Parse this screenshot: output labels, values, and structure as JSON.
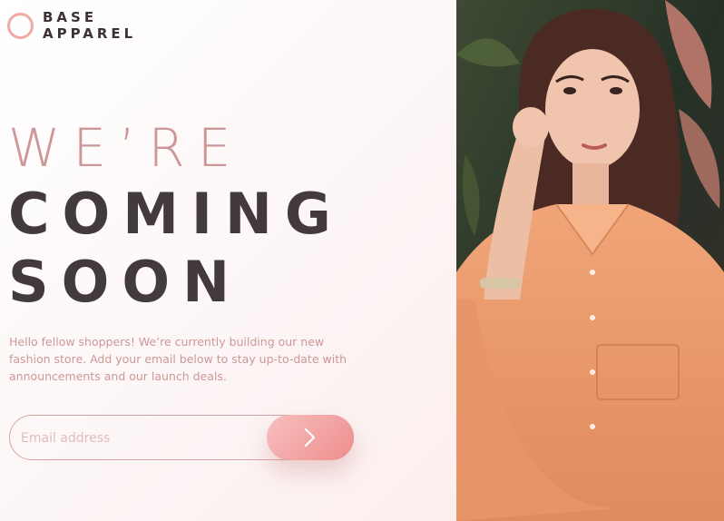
{
  "brand": {
    "line1": "BASE",
    "line2": "APPAREL"
  },
  "headline": {
    "light": "WE’RE",
    "dark1": "COMING",
    "dark2": "SOON"
  },
  "description": "Hello fellow shoppers! We’re currently building our new fashion store. Add your email below to stay up-to-date with announcements and our launch deals.",
  "form": {
    "placeholder": "Email address",
    "submit_icon": "chevron-right-icon"
  },
  "hero_image": {
    "subject": "woman in peach shirt"
  },
  "colors": {
    "accent": "#ce9797",
    "dark": "#423a3b",
    "button_start": "#f8bfbf",
    "button_end": "#ee8c8c"
  }
}
